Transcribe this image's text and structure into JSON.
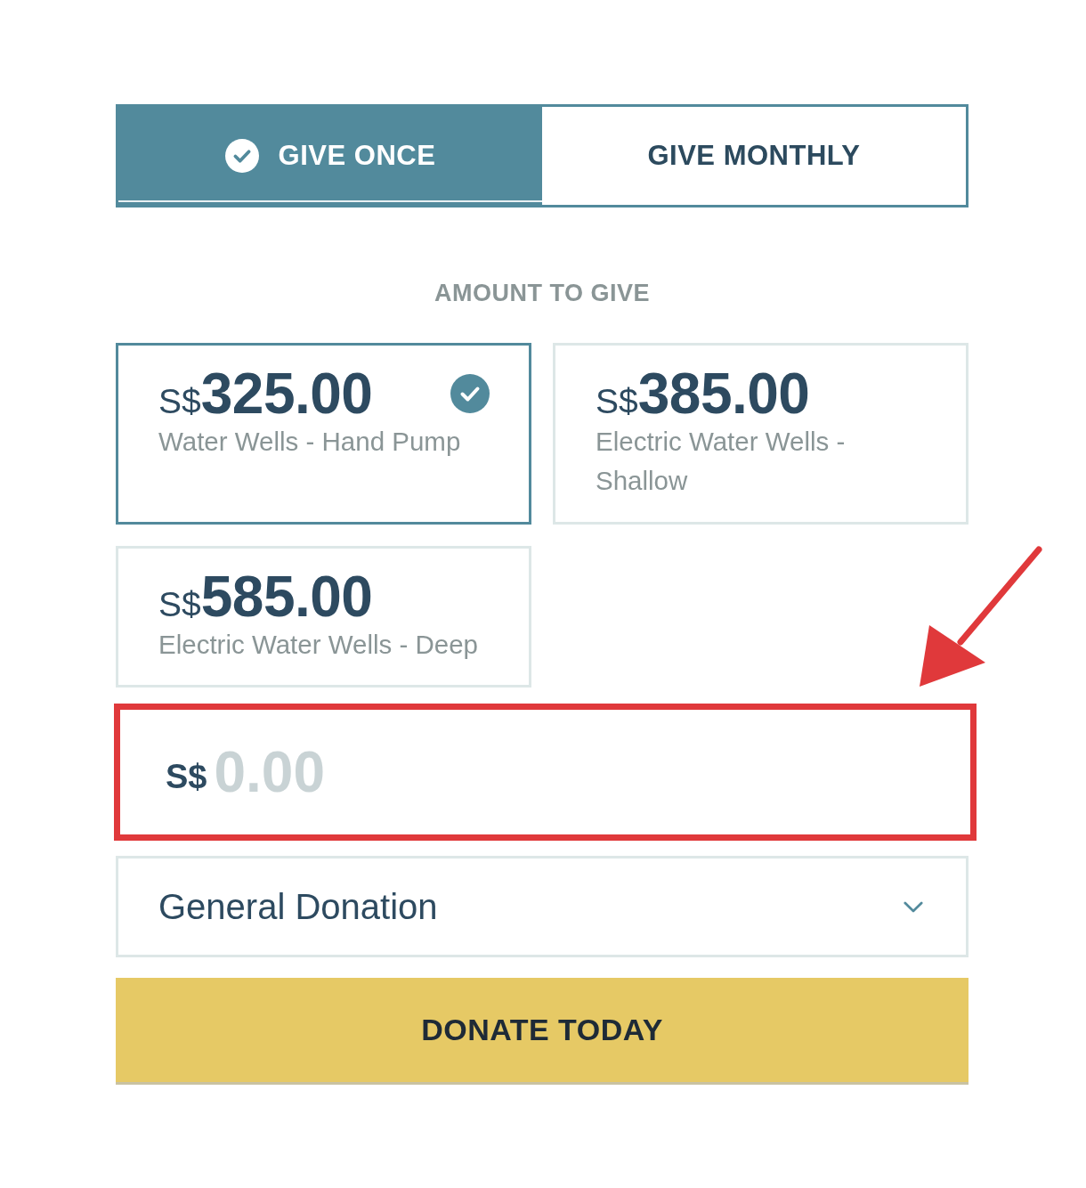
{
  "tabs": [
    {
      "label": "GIVE ONCE",
      "selected": true
    },
    {
      "label": "GIVE MONTHLY",
      "selected": false
    }
  ],
  "amount_heading": "AMOUNT TO GIVE",
  "amounts": [
    {
      "currency": "S$",
      "value": "325.00",
      "description": "Water Wells - Hand Pump",
      "selected": true
    },
    {
      "currency": "S$",
      "value": "385.00",
      "description": "Electric Water Wells - Shallow",
      "selected": false
    },
    {
      "currency": "S$",
      "value": "585.00",
      "description": "Electric Water Wells - Deep",
      "selected": false
    }
  ],
  "custom_amount": {
    "currency": "S$",
    "placeholder": "0.00",
    "highlighted": true
  },
  "designation_select": {
    "value": "General Donation"
  },
  "donate_button": "DONATE TODAY",
  "annotations": [
    {
      "kind": "arrow"
    }
  ]
}
